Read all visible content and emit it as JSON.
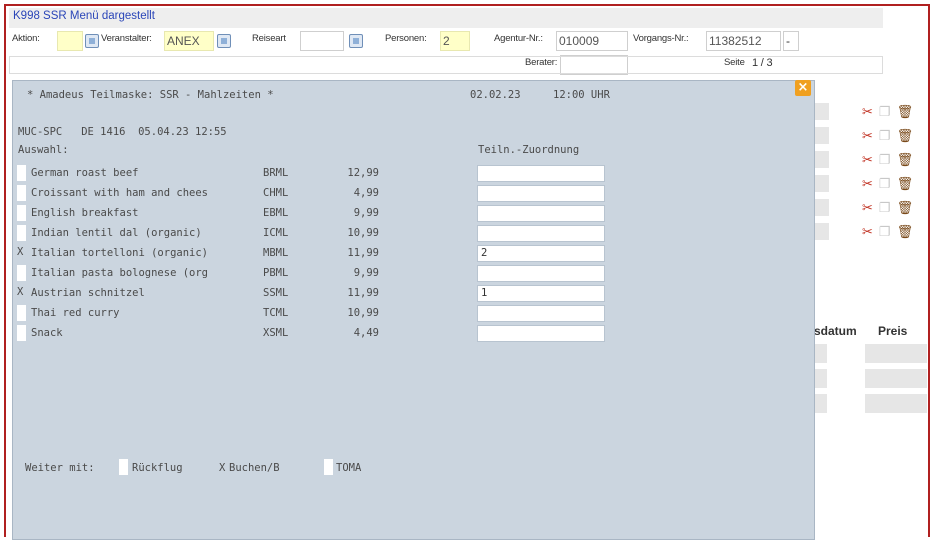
{
  "window": {
    "title": "K998 SSR Menü dargestellt"
  },
  "form": {
    "aktion_label": "Aktion:",
    "aktion_value": "",
    "veranstalter_label": "Veranstalter:",
    "veranstalter_value": "ANEX",
    "reiseart_label": "Reiseart",
    "reiseart_value": "",
    "personen_label": "Personen:",
    "personen_value": "2",
    "agentur_label": "Agentur-Nr.:",
    "agentur_value": "010009",
    "vorgang_label": "Vorgangs-Nr.:",
    "vorgang_value": "11382512",
    "vorgang_suffix": "-",
    "berater_label": "Berater:",
    "berater_value": "",
    "seite_label": "Seite",
    "seite_value": "1 / 3"
  },
  "right_panel": {
    "col_datum": "sdatum",
    "col_preis": "Preis",
    "icons": [
      "scissors-icon",
      "copy-icon",
      "trash-icon"
    ]
  },
  "dialog": {
    "header": "* Amadeus Teilmaske: SSR - Mahlzeiten *",
    "date": "02.02.23",
    "time": "12:00 UHR",
    "flight_info": "MUC-SPC   DE 1416  05.04.23 12:55",
    "auswahl_label": "Auswahl:",
    "zuordnung_label": "Teiln.-Zuordnung",
    "meals": [
      {
        "mark": "",
        "name": "German roast beef",
        "code": "BRML",
        "price": "12,99",
        "assign": ""
      },
      {
        "mark": "",
        "name": "Croissant with ham and chees",
        "code": "CHML",
        "price": "4,99",
        "assign": ""
      },
      {
        "mark": "",
        "name": "English breakfast",
        "code": "EBML",
        "price": "9,99",
        "assign": ""
      },
      {
        "mark": "",
        "name": "Indian lentil dal (organic)",
        "code": "ICML",
        "price": "10,99",
        "assign": ""
      },
      {
        "mark": "X",
        "name": "Italian tortelloni (organic)",
        "code": "MBML",
        "price": "11,99",
        "assign": "2"
      },
      {
        "mark": "",
        "name": "Italian pasta bolognese (org",
        "code": "PBML",
        "price": "9,99",
        "assign": ""
      },
      {
        "mark": "X",
        "name": "Austrian schnitzel",
        "code": "SSML",
        "price": "11,99",
        "assign": "1"
      },
      {
        "mark": "",
        "name": "Thai red curry",
        "code": "TCML",
        "price": "10,99",
        "assign": ""
      },
      {
        "mark": "",
        "name": "Snack",
        "code": "XSML",
        "price": "4,49",
        "assign": ""
      }
    ],
    "weiter_label": "Weiter mit:",
    "options": [
      {
        "mark": "",
        "label": "Rückflug"
      },
      {
        "mark": "X",
        "label": "Buchen/B"
      },
      {
        "mark": "",
        "label": "TOMA"
      }
    ],
    "close_label": "×"
  }
}
